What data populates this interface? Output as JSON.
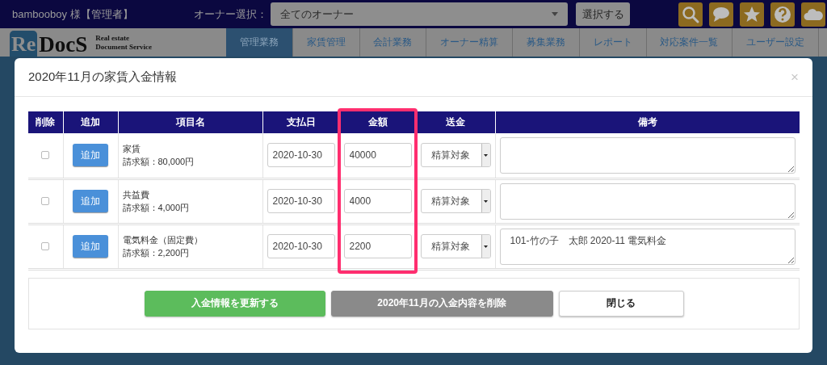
{
  "top_bar": {
    "user": "bambooboy 様【管理者】",
    "owner_label": "オーナー選択：",
    "owner_select": {
      "value": "全てのオーナー"
    },
    "select_button": "選択する"
  },
  "logo": {
    "mark": "Re",
    "name": "DocS",
    "tagline": [
      "Real estate",
      "Document Service"
    ]
  },
  "nav_tabs": [
    {
      "label": "管理業務",
      "selected": true
    },
    {
      "label": "家賃管理",
      "selected": false
    },
    {
      "label": "会計業務",
      "selected": false
    },
    {
      "label": "オーナー精算",
      "selected": false
    },
    {
      "label": "募集業務",
      "selected": false
    },
    {
      "label": "レポート",
      "selected": false
    },
    {
      "label": "対応案件一覧",
      "selected": false
    },
    {
      "label": "ユーザー設定",
      "selected": false
    }
  ],
  "modal": {
    "title": "2020年11月の家賃入金情報",
    "close": "×",
    "table": {
      "columns": [
        {
          "label": "削除",
          "highlighted": false
        },
        {
          "label": "追加",
          "highlighted": false
        },
        {
          "label": "項目名",
          "highlighted": false
        },
        {
          "label": "支払日",
          "highlighted": false
        },
        {
          "label": "金額",
          "highlighted": true
        },
        {
          "label": "送金",
          "highlighted": false
        },
        {
          "label": "備考",
          "highlighted": false
        }
      ],
      "rows": [
        {
          "checked": false,
          "add_button": "追加",
          "item": "家賃",
          "billing": "請求額：80,000円",
          "date": "2020-10-30",
          "amount": "40000",
          "remittance": "精算対象"
        },
        {
          "checked": false,
          "add_button": "追加",
          "item": "共益費",
          "billing": "請求額：4,000円",
          "date": "2020-10-30",
          "amount": "4000",
          "remittance": "精算対象"
        },
        {
          "checked": false,
          "add_button": "追加",
          "item": "電気料金（固定費）",
          "billing": "請求額：2,200円",
          "date": "2020-10-30",
          "amount": "2200",
          "remittance": "精算対象",
          "note": "101-竹の子　太郎 2020-11 電気料金"
        }
      ]
    },
    "buttons": [
      {
        "label": "入金情報を更新する",
        "kind": "primary"
      },
      {
        "label": "2020年11月の入金内容を削除",
        "kind": "danger"
      },
      {
        "label": "閉じる",
        "kind": "default"
      }
    ]
  }
}
